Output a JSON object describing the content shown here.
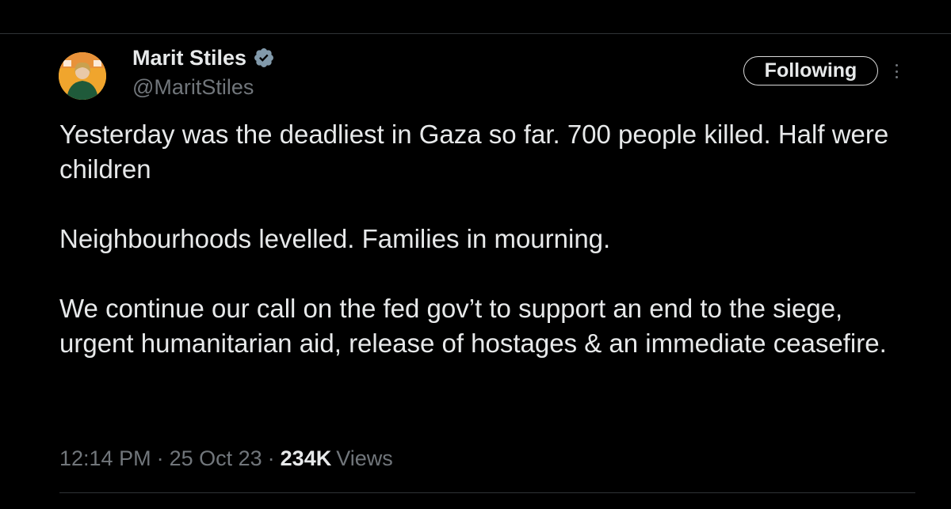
{
  "author": {
    "name": "Marit Stiles",
    "handle": "@MaritStiles",
    "verified": true
  },
  "follow_button": {
    "label": "Following"
  },
  "tweet": {
    "paragraphs": [
      "Yesterday was the deadliest in Gaza so far. 700 people killed. Half were children",
      "Neighbourhoods levelled. Families in mourning.",
      "We continue our call on the fed gov’t to support an end to the siege, urgent humanitarian aid, release of hostages & an immediate ceasefire."
    ]
  },
  "meta": {
    "time": "12:14 PM",
    "separator": "·",
    "date": "25 Oct 23",
    "views_count": "234K",
    "views_label": "Views"
  },
  "colors": {
    "background": "#000000",
    "text_primary": "#e7e9ea",
    "text_secondary": "#71767b",
    "verified_badge": "#829aab",
    "avatar_background": "#f3b23a"
  }
}
